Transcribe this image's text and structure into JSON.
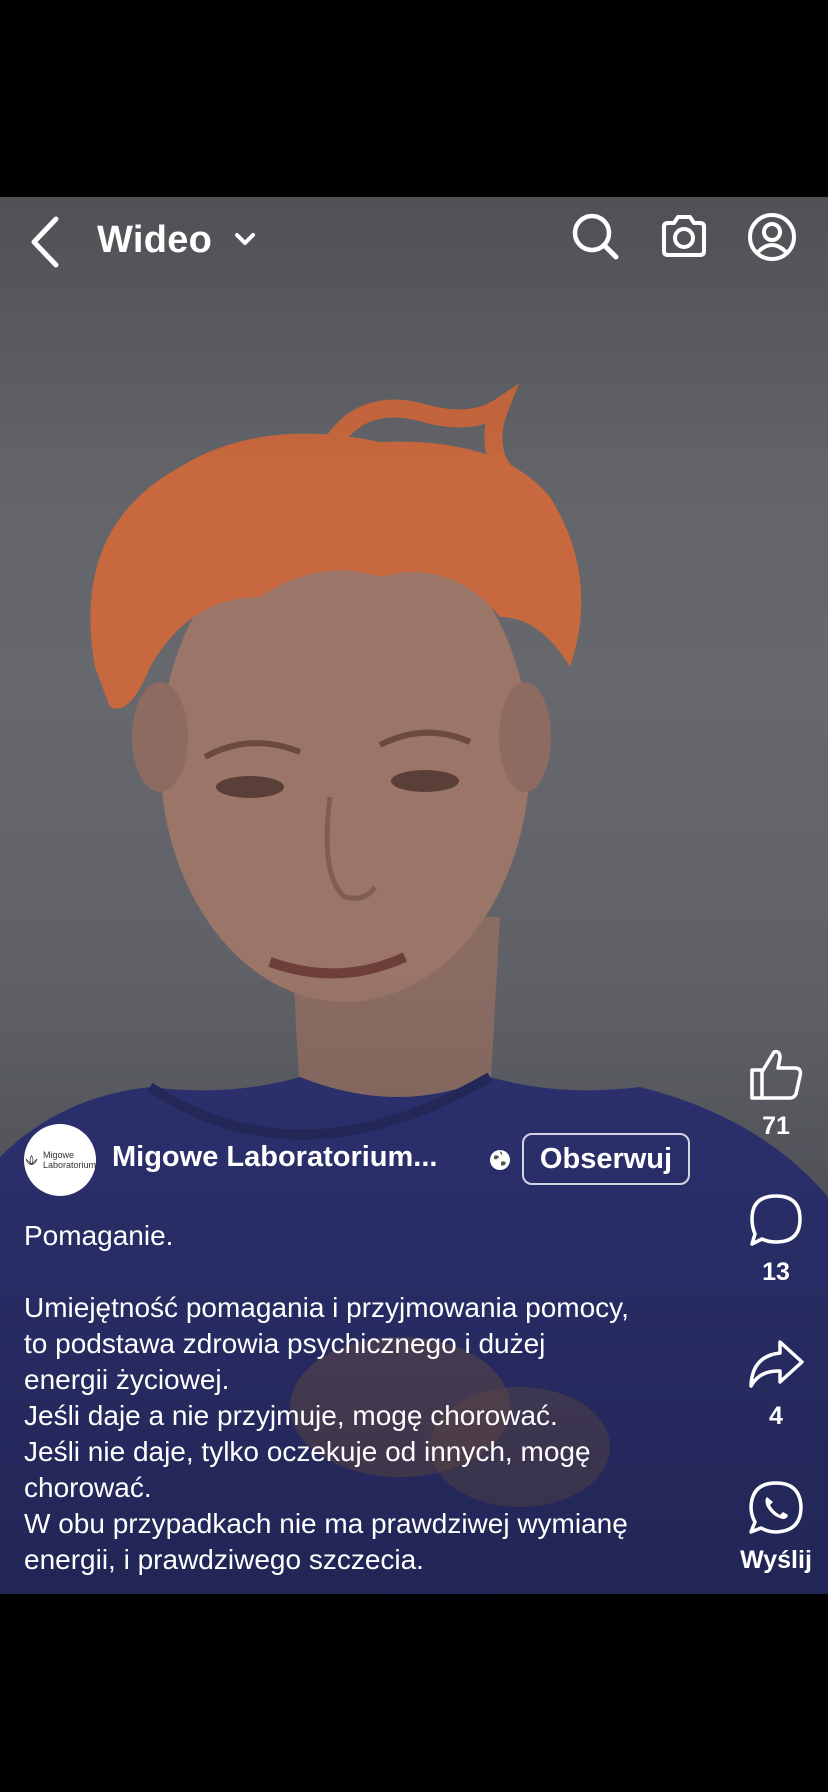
{
  "header": {
    "title": "Wideo"
  },
  "post": {
    "author_name": "Migowe Laboratorium...",
    "avatar_text_line1": "Migowe",
    "avatar_text_line2": "Laboratorium",
    "follow_label": "Obserwuj",
    "caption": [
      "Pomaganie.",
      "",
      "Umiejętność pomagania i przyjmowania pomocy,",
      "to podstawa zdrowia psychicznego i dużej",
      "energii życiowej.",
      "Jeśli daje a nie przyjmuje, mogę chorować.",
      "Jeśli nie daje, tylko oczekuje od innych, mogę",
      "chorować.",
      "W obu przypadkach nie ma prawdziwej wymianę",
      "energii, i prawdziwego szczecia."
    ]
  },
  "actions": {
    "likes": "71",
    "comments": "13",
    "shares": "4",
    "send_label": "Wyślij"
  },
  "icons": {
    "back": "chevron-left-icon",
    "dropdown": "chevron-down-icon",
    "search": "search-icon",
    "camera": "camera-icon",
    "profile": "profile-icon",
    "globe": "globe-icon",
    "like": "thumbs-up-icon",
    "comment": "comment-icon",
    "share": "share-arrow-icon",
    "whatsapp": "whatsapp-icon"
  },
  "colors": {
    "background": "#000000",
    "hair": "#c8683e",
    "shirt": "#2d3272"
  }
}
